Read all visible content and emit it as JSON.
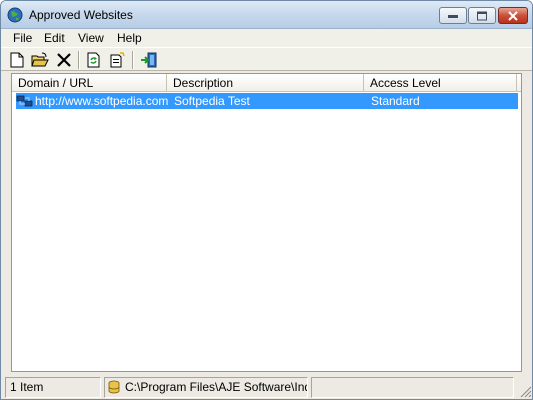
{
  "window": {
    "title": "Approved Websites",
    "icon": "globe-icon"
  },
  "menu": {
    "items": [
      "File",
      "Edit",
      "View",
      "Help"
    ]
  },
  "toolbar": {
    "buttons": [
      "new-icon",
      "open-folder-icon",
      "delete-icon",
      "refresh-icon",
      "properties-icon",
      "exit-icon"
    ]
  },
  "list": {
    "columns": [
      "Domain / URL",
      "Description",
      "Access Level"
    ],
    "rows": [
      {
        "url": "http://www.softpedia.com",
        "description": "Softpedia Test",
        "access": "Standard",
        "icon": "network-icon"
      }
    ]
  },
  "status": {
    "count": "1 Item",
    "path": "C:\\Program Files\\AJE Software\\Indigc"
  },
  "colors": {
    "selection": "#3399ff",
    "window_bg": "#eceae3"
  }
}
